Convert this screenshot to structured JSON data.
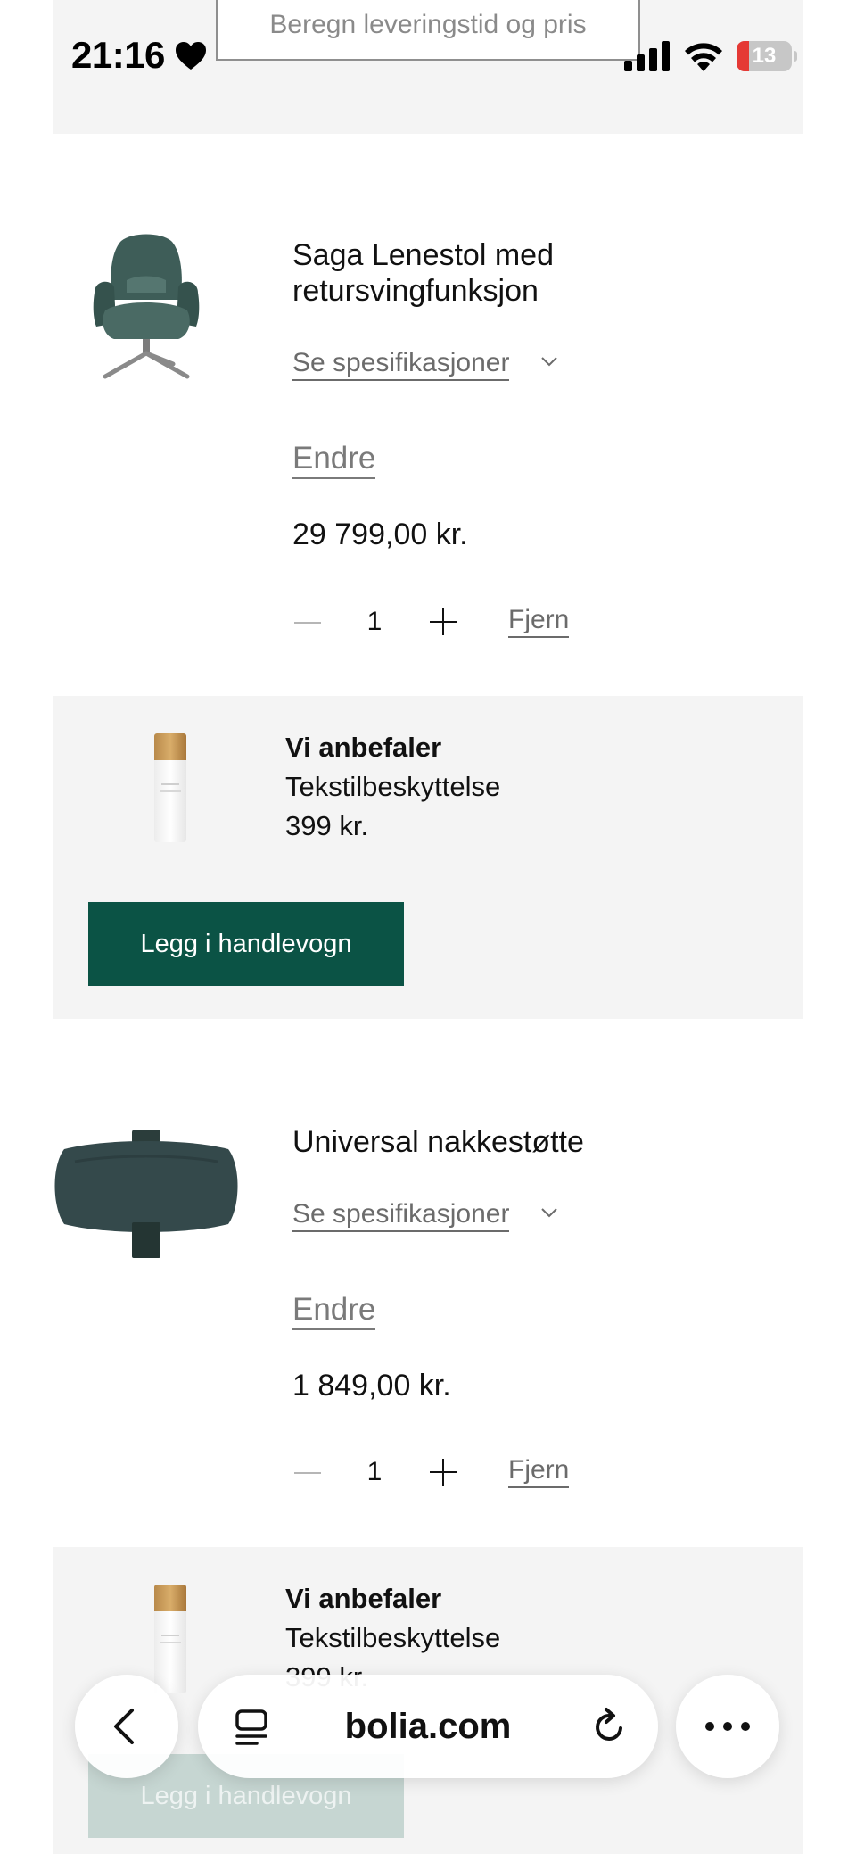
{
  "status_bar": {
    "time": "21:16",
    "battery": "13"
  },
  "top": {
    "delivery_label": "Beregn leveringstid og pris"
  },
  "products": [
    {
      "title_line1": "Saga Lenestol med",
      "title_line2": "retursvingfunksjon",
      "spec_label": "Se spesifikasjoner",
      "change_label": "Endre",
      "price": "29 799,00 kr.",
      "quantity": "1",
      "remove_label": "Fjern",
      "image": "armchair"
    },
    {
      "title_line1": "Universal nakkestøtte",
      "spec_label": "Se spesifikasjoner",
      "change_label": "Endre",
      "price": "1 849,00 kr.",
      "quantity": "1",
      "remove_label": "Fjern",
      "image": "headrest"
    }
  ],
  "recommendations": [
    {
      "heading": "Vi anbefaler",
      "name": "Tekstilbeskyttelse",
      "price": "399 kr.",
      "button": "Legg i handlevogn"
    },
    {
      "heading": "Vi anbefaler",
      "name": "Tekstilbeskyttelse",
      "price": "399 kr.",
      "button": "Legg i handlevogn"
    }
  ],
  "browser": {
    "url": "bolia.com"
  },
  "colors": {
    "accent": "#0b5345",
    "panel": "#f4f4f4",
    "muted_text": "#6b6b6b"
  }
}
